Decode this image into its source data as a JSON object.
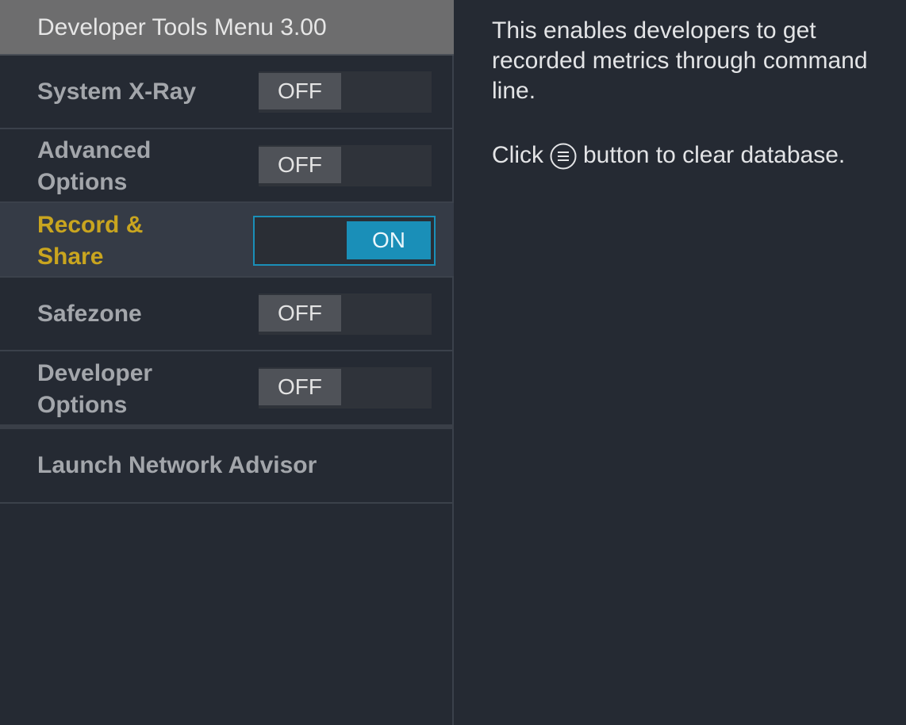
{
  "header": {
    "title": "Developer Tools Menu 3.00"
  },
  "menu": {
    "items": [
      {
        "label": "System X-Ray",
        "toggle": "OFF"
      },
      {
        "label_line1": "Advanced",
        "label_line2": "Options",
        "toggle": "OFF"
      },
      {
        "label_line1": "Record &",
        "label_line2": "Share",
        "toggle": "ON"
      },
      {
        "label": "Safezone",
        "toggle": "OFF"
      },
      {
        "label_line1": "Developer",
        "label_line2": "Options",
        "toggle": "OFF"
      },
      {
        "label": "Launch Network Advisor"
      }
    ]
  },
  "description": {
    "text": "This enables developers to get recorded metrics through command line.",
    "click_prefix": "Click",
    "click_icon": "menu-circle-icon",
    "click_suffix": "button to clear database."
  },
  "colors": {
    "highlight_label": "#c9a51f",
    "toggle_on": "#1a8fb8",
    "header_bg": "#6d6d6e",
    "background": "#252a33"
  }
}
